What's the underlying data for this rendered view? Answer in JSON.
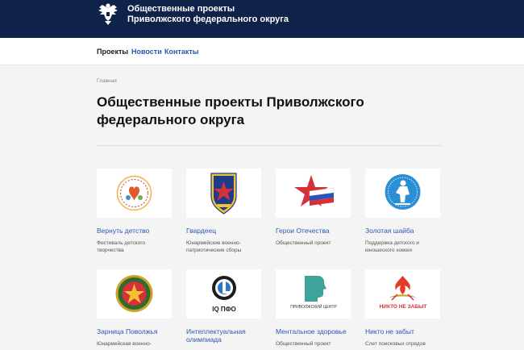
{
  "header": {
    "title_line1": "Общественные проекты",
    "title_line2": "Приволжского федерального округа",
    "emblem_icon": "double-headed-eagle-icon",
    "background": "#0f2249"
  },
  "nav": {
    "items": [
      {
        "label": "Проекты",
        "active": true
      },
      {
        "label": "Новости",
        "active": false
      },
      {
        "label": "Контакты",
        "active": false
      }
    ],
    "link_color": "#2e55b5"
  },
  "breadcrumb": "Главная",
  "page_title": "Общественные проекты Приволжского федерального округа",
  "projects": [
    {
      "title": "Вернуть детство",
      "desc": "Фестиваль детского творчества",
      "logo_icon": "children-festival-logo"
    },
    {
      "title": "Гвардеец",
      "desc": "Юнармейские военно-патриотические сборы",
      "logo_icon": "guardsman-shield-logo"
    },
    {
      "title": "Герои Отечества",
      "desc": "Общественный проект",
      "logo_icon": "red-star-flag-logo"
    },
    {
      "title": "Золотая шайба",
      "desc": "Поддержка детского и юношеского хоккея",
      "logo_icon": "hockey-player-logo"
    },
    {
      "title": "Зарница Поволжья",
      "desc": "Юнармейская военно-",
      "logo_icon": "zarnitsa-emblem-logo"
    },
    {
      "title": "Интеллектуальная олимпиада",
      "desc": "",
      "logo_icon": "iq-pfo-logo",
      "logo_text": "IQ ПФО"
    },
    {
      "title": "Ментальное здоровье",
      "desc": "Общественный проект",
      "logo_icon": "head-silhouette-logo",
      "logo_text": "ПРИВОЛЖСКИЙ ЦЕНТР"
    },
    {
      "title": "Никто не забыт",
      "desc": "Слет поисковых отрядов",
      "logo_icon": "eternal-flame-logo",
      "logo_text": "НИКТО НЕ ЗАБЫТ"
    }
  ]
}
